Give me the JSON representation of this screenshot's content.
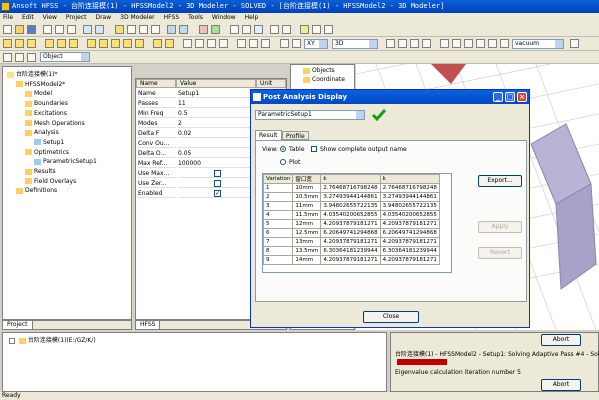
{
  "window": {
    "title": "Ansoft HFSS - 台阶连接模(1) - HFSSModel2 - 3D Modeler - SOLVED - [台阶连接模(1) - HFSSModel2 - 3D Modeler]"
  },
  "menu": [
    "File",
    "Edit",
    "View",
    "Project",
    "Draw",
    "3D Modeler",
    "HFSS",
    "Tools",
    "Window",
    "Help"
  ],
  "toolbar": {
    "object_combo": "Object",
    "xy_combo": "XY",
    "dim_combo": "3D",
    "material_combo": "vacuum"
  },
  "project_tree": [
    {
      "label": "台阶连接模(1)*",
      "indent": 0
    },
    {
      "label": "HFSSModel2*",
      "indent": 1
    },
    {
      "label": "Model",
      "indent": 2
    },
    {
      "label": "Boundaries",
      "indent": 2
    },
    {
      "label": "Excitations",
      "indent": 2
    },
    {
      "label": "Mesh Operations",
      "indent": 2
    },
    {
      "label": "Analysis",
      "indent": 2
    },
    {
      "label": "Setup1",
      "indent": 3
    },
    {
      "label": "Optimetrics",
      "indent": 2
    },
    {
      "label": "ParametricSetup1",
      "indent": 3
    },
    {
      "label": "Results",
      "indent": 2
    },
    {
      "label": "Field Overlays",
      "indent": 2
    },
    {
      "label": "Definitions",
      "indent": 1
    }
  ],
  "project_tab": "Project",
  "properties": {
    "col_name": "Name",
    "col_value": "Value",
    "col_unit": "Unit",
    "rows": [
      {
        "name": "Name",
        "value": "Setup1"
      },
      {
        "name": "Passes",
        "value": "11"
      },
      {
        "name": "Min Freq",
        "value": "0.5"
      },
      {
        "name": "Modes",
        "value": "2"
      },
      {
        "name": "Delta F",
        "value": "0.02"
      },
      {
        "name": "Conv Ou...",
        "value": ""
      },
      {
        "name": "Delta O...",
        "value": "0.05"
      },
      {
        "name": "Max Ref...",
        "value": "100000"
      },
      {
        "name": "Use Max...",
        "value": ""
      },
      {
        "name": "Use Zer...",
        "value": ""
      },
      {
        "name": "Enabled",
        "value": ""
      }
    ],
    "tab": "HFSS"
  },
  "model_tree": [
    "Objects",
    "Coordinate"
  ],
  "dialog": {
    "title": "Post Analysis Display",
    "setup_combo": "ParametricSetup1",
    "tabs": [
      "Result",
      "Profile"
    ],
    "view_label": "View:",
    "radio_table": "Table",
    "checkbox_show_complete": "Show complete output name",
    "radio_plot": "Plot",
    "table_headers": [
      "Variation",
      "窗口宽",
      "k",
      "k"
    ],
    "table_rows": [
      [
        "1",
        "10mm",
        "2.76468716798248",
        "2.76468716798248"
      ],
      [
        "2",
        "10.5mm",
        "3.27493944144861",
        "3.27493944144861"
      ],
      [
        "3",
        "11mm",
        "3.94802655722135",
        "3.94802655722135"
      ],
      [
        "4",
        "11.5mm",
        "4.03540200652855",
        "4.03540200652855"
      ],
      [
        "5",
        "12mm",
        "4.20937879181271",
        "4.20937879181271"
      ],
      [
        "6",
        "12.5mm",
        "6.20649741294868",
        "6.20649741294868"
      ],
      [
        "7",
        "13mm",
        "4.20937879181271",
        "4.20937879181271"
      ],
      [
        "8",
        "13.5mm",
        "6.30364181239944",
        "6.30364181239944"
      ],
      [
        "9",
        "14mm",
        "4.20937879181271",
        "4.20937879181271"
      ]
    ],
    "export_button": "Export...",
    "apply_button": "Apply",
    "revert_button": "Revert",
    "close_button": "Close"
  },
  "messages_tree": "台阶连接模(1)(E:/GZ/K/)",
  "progress": {
    "text": "台阶连接模(1) - HFSSModel2 - Setup1: Solving Adaptive Pass #4 - Solving Fi",
    "eigen_text": "Eigenvalue calculation iteration number 5",
    "abort_label": "Abort",
    "abort2_label": "Abort"
  },
  "status": "Ready"
}
